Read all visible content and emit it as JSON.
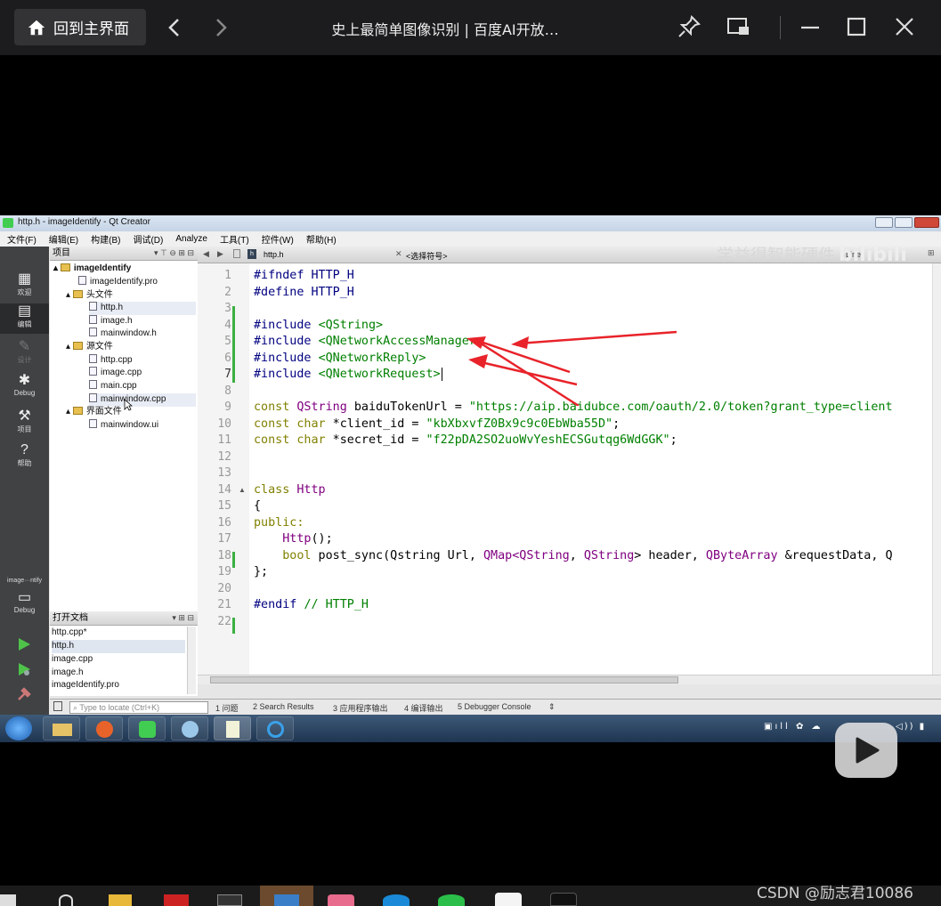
{
  "viewer": {
    "home_label": "回到主界面",
    "title": "史上最简单图像识别 | 百度AI开放…"
  },
  "qt": {
    "window_title": "http.h - imageIdentify - Qt Creator",
    "menu": [
      "文件(F)",
      "编辑(E)",
      "构建(B)",
      "调试(D)",
      "Analyze",
      "工具(T)",
      "控件(W)",
      "帮助(H)"
    ],
    "modes": [
      "欢迎",
      "编辑",
      "设计",
      "Debug",
      "项目",
      "帮助"
    ],
    "kit_label": "image···ntify",
    "kit_mode": "Debug",
    "project_header": "项目",
    "tree": {
      "root": "imageIdentify",
      "pro": "imageIdentify.pro",
      "headers_folder": "头文件",
      "headers": [
        "http.h",
        "image.h",
        "mainwindow.h"
      ],
      "sources_folder": "源文件",
      "sources": [
        "http.cpp",
        "image.cpp",
        "main.cpp",
        "mainwindow.cpp"
      ],
      "forms_folder": "界面文件",
      "forms": [
        "mainwindow.ui"
      ]
    },
    "open_docs_header": "打开文档",
    "open_docs": [
      "http.cpp*",
      "http.h",
      "image.cpp",
      "image.h",
      "imageIdentify.pro"
    ],
    "editor": {
      "file_tab": "http.h",
      "symbol_placeholder": "<选择符号>",
      "line_info": "Line",
      "watermark": "学益得智能硬件",
      "watermark_brand": "bilibili"
    },
    "locate_placeholder": "Type to locate (Ctrl+K)",
    "output_tabs": [
      "1 问题",
      "2 Search Results",
      "3 应用程序输出",
      "4 编译输出",
      "5 Debugger Console"
    ]
  },
  "code": {
    "line_numbers": [
      "1",
      "2",
      "3",
      "4",
      "5",
      "6",
      "7",
      "8",
      "9",
      "10",
      "11",
      "12",
      "13",
      "14",
      "15",
      "16",
      "17",
      "18",
      "19",
      "20",
      "21",
      "22"
    ],
    "l1": "#ifndef HTTP_H",
    "l2": "#define HTTP_H",
    "l4_a": "#include ",
    "l4_b": "<QString>",
    "l5_a": "#include ",
    "l5_b": "<QNetworkAccessManager>",
    "l6_a": "#include ",
    "l6_b": "<QNetworkReply>",
    "l7_a": "#include ",
    "l7_b": "<QNetworkRequest>",
    "l9_a": "const ",
    "l9_b": "QString",
    "l9_c": " baiduTokenUrl = ",
    "l9_d": "\"https://aip.baidubce.com/oauth/2.0/token?grant_type=client",
    "l10_a": "const ",
    "l10_b": "char",
    "l10_c": " *client_id = ",
    "l10_d": "\"kbXbxvfZ0Bx9c9c0EbWba55D\"",
    "l10_e": ";",
    "l11_a": "const ",
    "l11_b": "char",
    "l11_c": " *secret_id = ",
    "l11_d": "\"f22pDA2SO2uoWvYeshECSGutqg6WdGGK\"",
    "l11_e": ";",
    "l14_a": "class ",
    "l14_b": "Http",
    "l15": "{",
    "l16": "public:",
    "l17_a": "    ",
    "l17_b": "Http",
    "l17_c": "();",
    "l18_a": "    ",
    "l18_b": "bool",
    "l18_c": " post_sync(Qstring Url, ",
    "l18_d": "QMap<QString",
    "l18_e": ", ",
    "l18_f": "QString",
    "l18_g": "> header, ",
    "l18_h": "QByteArray",
    "l18_i": " &requestData, Q",
    "l19": "};",
    "l21_a": "#endif ",
    "l21_b": "// HTTP_H"
  },
  "annotation_color": "#e8232a",
  "credit": "CSDN @励志君10086"
}
